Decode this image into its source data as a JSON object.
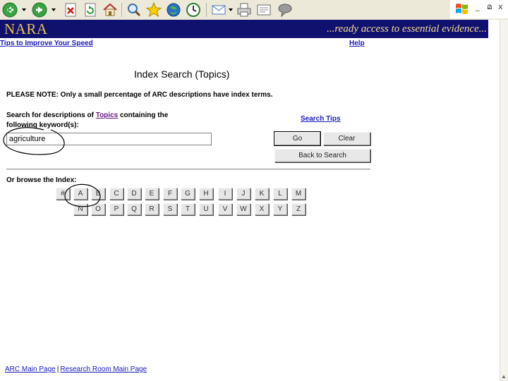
{
  "toolbar": {
    "icons": [
      "back-icon",
      "forward-icon",
      "stop-icon",
      "refresh-icon",
      "home-icon",
      "search-icon",
      "favorites-icon",
      "media-icon",
      "history-icon",
      "mail-icon",
      "print-icon",
      "edit-icon",
      "discuss-icon",
      "windows-logo"
    ]
  },
  "window_controls": {
    "minimize": "_",
    "restore": "മ",
    "close": "x"
  },
  "banner": {
    "logo": "NARA",
    "tagline": "...ready access to essential evidence...",
    "logo_color": "#e8c352",
    "background_color": "#10106e"
  },
  "links": {
    "tips_speed": "Tips to Improve Your Speed",
    "help": "Help"
  },
  "page": {
    "title": "Index Search (Topics)",
    "notice": "PLEASE NOTE: Only a small percentage of ARC descriptions have index terms."
  },
  "search": {
    "label_before": "Search for descriptions of ",
    "label_link": "Topics",
    "label_after": " containing the following keyword(s):",
    "value": "agriculture",
    "tips_label": "Search Tips",
    "go_label": "Go",
    "clear_label": "Clear",
    "back_label": "Back to Search"
  },
  "browse": {
    "label": "Or browse the Index:",
    "row1": [
      "#",
      "A",
      "B",
      "C",
      "D",
      "E",
      "F",
      "G",
      "H",
      "I",
      "J",
      "K",
      "L",
      "M"
    ],
    "row2": [
      "N",
      "O",
      "P",
      "Q",
      "R",
      "S",
      "T",
      "U",
      "V",
      "W",
      "X",
      "Y",
      "Z"
    ]
  },
  "footer": {
    "arc_main": "ARC Main Page",
    "separator": "|",
    "research_room": "Research Room Main Page"
  },
  "colors": {
    "link": "#1a1ab8",
    "visited_link": "#6b1a8a",
    "annotation_circle": "#000000"
  }
}
